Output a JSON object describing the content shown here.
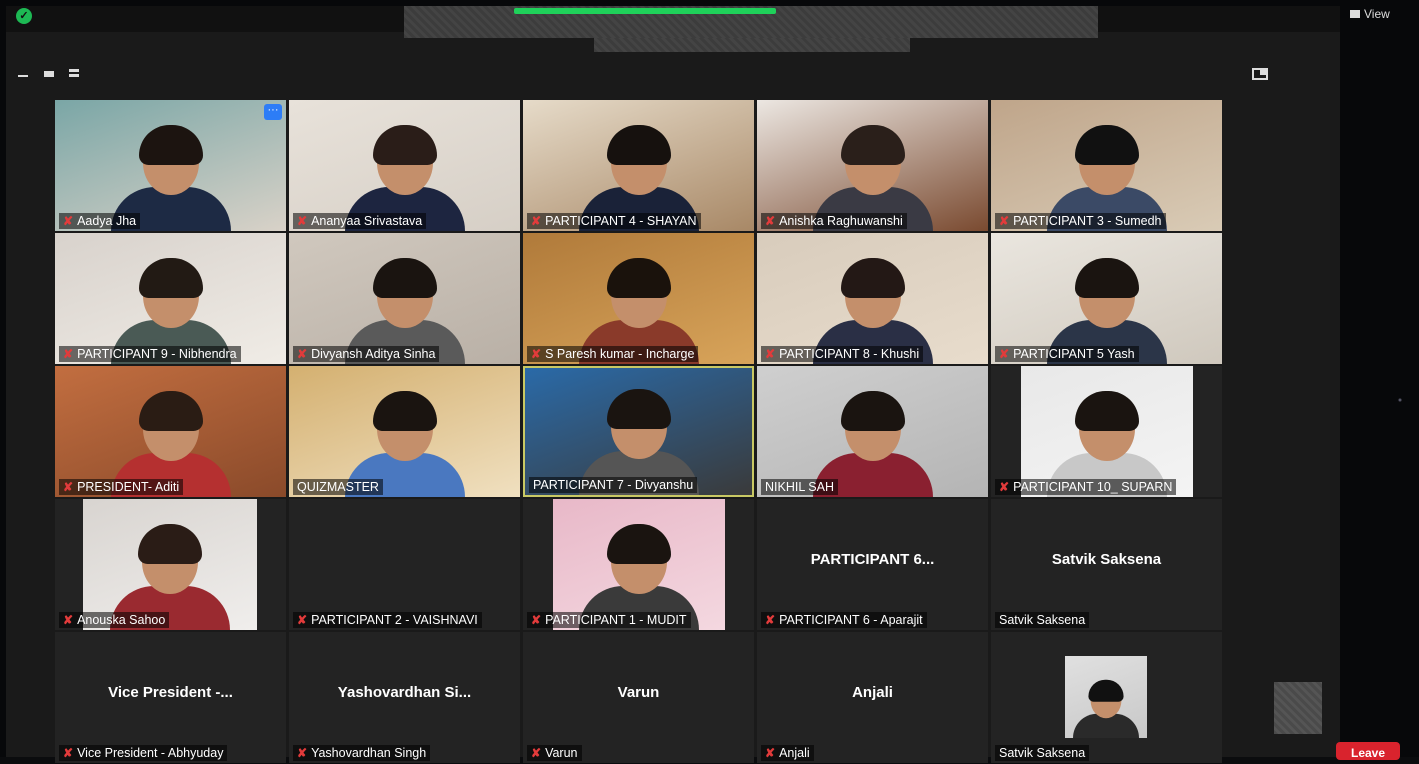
{
  "window": {
    "view_label": "View",
    "leave_label": "Leave"
  },
  "participants": [
    {
      "name": "Aadya Jha",
      "muted": true,
      "video": true
    },
    {
      "name": "Ananyaa Srivastava",
      "muted": true,
      "video": true
    },
    {
      "name": "PARTICIPANT 4 - SHAYAN",
      "muted": true,
      "video": true
    },
    {
      "name": "Anishka Raghuwanshi",
      "muted": true,
      "video": true
    },
    {
      "name": "PARTICIPANT 3 - Sumedh",
      "muted": true,
      "video": true
    },
    {
      "name": "PARTICIPANT 9 - Nibhendra",
      "muted": true,
      "video": true
    },
    {
      "name": "Divyansh Aditya Sinha",
      "muted": true,
      "video": true
    },
    {
      "name": "S Paresh kumar - Incharge",
      "muted": true,
      "video": true
    },
    {
      "name": "PARTICIPANT 8 - Khushi",
      "muted": true,
      "video": true
    },
    {
      "name": "PARTICIPANT 5 Yash",
      "muted": true,
      "video": true
    },
    {
      "name": "PRESIDENT- Aditi",
      "muted": true,
      "video": true
    },
    {
      "name": "QUIZMASTER",
      "muted": false,
      "video": true
    },
    {
      "name": "PARTICIPANT 7 - Divyanshu",
      "muted": false,
      "video": true,
      "speaking": true
    },
    {
      "name": "NIKHIL SAH",
      "muted": false,
      "video": true
    },
    {
      "name": "PARTICIPANT 10_ SUPARN",
      "muted": true,
      "video": true
    },
    {
      "name": "Anouska Sahoo",
      "muted": true,
      "video": true
    },
    {
      "name": "PARTICIPANT 2 - VAISHNAVI",
      "muted": true,
      "video": false,
      "center": ""
    },
    {
      "name": "PARTICIPANT 1 - MUDIT",
      "muted": true,
      "video": true
    },
    {
      "name": "PARTICIPANT 6 - Aparajit",
      "muted": true,
      "video": false,
      "center": "PARTICIPANT 6..."
    },
    {
      "name": "Satvik Saksena",
      "muted": false,
      "video": false,
      "center": "Satvik Saksena"
    },
    {
      "name": "Vice President - Abhyuday",
      "muted": true,
      "video": false,
      "center": "Vice President -..."
    },
    {
      "name": "Yashovardhan Singh",
      "muted": true,
      "video": false,
      "center": "Yashovardhan Si..."
    },
    {
      "name": "Varun",
      "muted": true,
      "video": false,
      "center": "Varun"
    },
    {
      "name": "Anjali",
      "muted": true,
      "video": false,
      "center": "Anjali"
    },
    {
      "name": "Satvik Saksena",
      "muted": false,
      "video": true
    }
  ],
  "colors": {
    "accent": "#2d7df6",
    "mute": "#e23b3b",
    "active_speaker": "#c9c964",
    "share_indicator": "#1fd15a",
    "leave": "#d9232d"
  },
  "icons": [
    "shield-icon",
    "minimize-icon",
    "speaker-view-icon",
    "strip-view-icon",
    "gallery-view-icon",
    "fullscreen-icon",
    "muted-mic-icon",
    "more-options-icon"
  ]
}
